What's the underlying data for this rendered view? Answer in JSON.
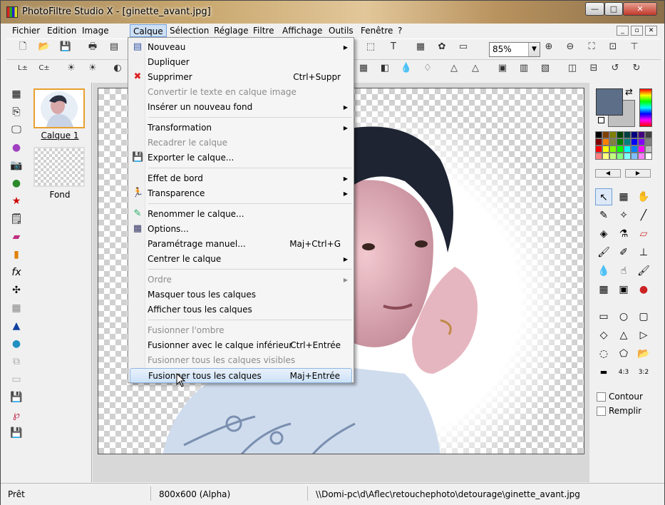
{
  "window": {
    "title": "PhotoFiltre Studio X - [ginette_avant.jpg]",
    "min": "—",
    "max": "□",
    "close": "✕"
  },
  "menubar": {
    "items": [
      "Fichier",
      "Edition",
      "Image",
      "Calque",
      "Sélection",
      "Réglage",
      "Filtre",
      "Affichage",
      "Outils",
      "Fenêtre",
      "?"
    ],
    "active": "Calque",
    "mdi_buttons": [
      "_",
      "▫",
      "✕"
    ]
  },
  "toolbar": {
    "zoom_value": "85%"
  },
  "layers": {
    "items": [
      {
        "label": "Calque 1",
        "selected": true
      },
      {
        "label": "Fond",
        "selected": false
      }
    ]
  },
  "calque_menu": {
    "groups": [
      [
        {
          "label": "Nouveau",
          "submenu": true,
          "icon": "new-layer-icon",
          "enabled": true
        },
        {
          "label": "Dupliquer",
          "enabled": true
        },
        {
          "label": "Supprimer",
          "shortcut": "Ctrl+Suppr",
          "icon": "delete-x-icon",
          "enabled": true
        },
        {
          "label": "Convertir le texte en calque image",
          "enabled": false
        },
        {
          "label": "Insérer un nouveau fond",
          "submenu": true,
          "enabled": true
        }
      ],
      [
        {
          "label": "Transformation",
          "submenu": true,
          "enabled": true
        },
        {
          "label": "Recadrer le calque",
          "enabled": false
        },
        {
          "label": "Exporter le calque...",
          "icon": "save-disk-icon",
          "enabled": true
        }
      ],
      [
        {
          "label": "Effet de bord",
          "submenu": true,
          "enabled": true
        },
        {
          "label": "Transparence",
          "submenu": true,
          "icon": "transparency-icon",
          "enabled": true
        }
      ],
      [
        {
          "label": "Renommer le calque...",
          "icon": "rename-pencil-icon",
          "enabled": true
        },
        {
          "label": "Options...",
          "icon": "options-icon",
          "enabled": true
        },
        {
          "label": "Paramétrage manuel...",
          "shortcut": "Maj+Ctrl+G",
          "enabled": true
        },
        {
          "label": "Centrer le calque",
          "submenu": true,
          "enabled": true
        }
      ],
      [
        {
          "label": "Ordre",
          "submenu": true,
          "enabled": false
        },
        {
          "label": "Masquer tous les calques",
          "enabled": true
        },
        {
          "label": "Afficher tous les calques",
          "enabled": true
        }
      ],
      [
        {
          "label": "Fusionner l'ombre",
          "enabled": false
        },
        {
          "label": "Fusionner avec le calque inférieur",
          "shortcut": "Ctrl+Entrée",
          "enabled": true
        },
        {
          "label": "Fusionner tous les calques visibles",
          "enabled": false
        },
        {
          "label": "Fusionner tous les calques",
          "shortcut": "Maj+Entrée",
          "enabled": true,
          "hover": true
        }
      ]
    ]
  },
  "right_panel": {
    "foreground_color": "#5c6e88",
    "background_color": "#c0c0c0",
    "palette": [
      "#000000",
      "#804000",
      "#808000",
      "#004000",
      "#004040",
      "#000080",
      "#400080",
      "#404040",
      "#800000",
      "#ff8000",
      "#808040",
      "#008000",
      "#008080",
      "#0000ff",
      "#8000ff",
      "#808080",
      "#ff0000",
      "#ffff00",
      "#80ff00",
      "#00ff00",
      "#00ffff",
      "#0080ff",
      "#ff00ff",
      "#c0c0c0",
      "#ff8080",
      "#ffff80",
      "#c0ff80",
      "#80ff80",
      "#80ffff",
      "#80c0ff",
      "#ff80ff",
      "#ffffff"
    ],
    "contour_label": "Contour",
    "remplir_label": "Remplir"
  },
  "statusbar": {
    "state": "Prêt",
    "size": "800x600 (Alpha)",
    "path": "\\\\Domi-pc\\d\\Aflec\\retouchephoto\\detourage\\ginette_avant.jpg"
  }
}
